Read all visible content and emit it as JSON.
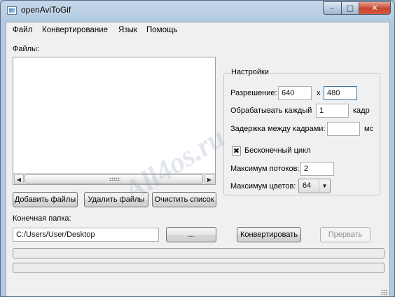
{
  "window": {
    "title": "openAviToGif",
    "minimize_glyph": "–",
    "maximize_glyph": "□",
    "close_glyph": "✕"
  },
  "menu": {
    "file": "Файл",
    "convert": "Конвертирование",
    "language": "Язык",
    "help": "Помощь"
  },
  "files": {
    "label": "Файлы:",
    "items": [],
    "scroll_left": "◀",
    "scroll_right": "▶"
  },
  "buttons": {
    "add_files": "Добавить файлы",
    "remove_files": "Удалить файлы",
    "clear_list": "Очистить список",
    "browse": "...",
    "convert": "Конвертировать",
    "abort": "Прервать"
  },
  "output": {
    "label": "Конечная папка:",
    "path": "C:/Users/User/Desktop"
  },
  "settings": {
    "title": "Настройки",
    "resolution_label": "Разрешение:",
    "width": "640",
    "times": "x",
    "height": "480",
    "process_every_label": "Обрабатывать каждый",
    "process_every": "1",
    "frame_unit": "кадр",
    "delay_label": "Задержка между кадрами:",
    "delay": "",
    "delay_unit": "мс",
    "loop_label": "Бесконечный цикл",
    "loop_checked": true,
    "loop_mark": "✖",
    "max_threads_label": "Максимум потоков:",
    "max_threads": "2",
    "max_colors_label": "Максимум цветов:",
    "max_colors": "64",
    "combo_arrow": "▼"
  },
  "progress": {
    "current": 0,
    "total": 0
  },
  "watermark": "All4os.ru",
  "colors": {
    "title_bar": "#b2c9df",
    "close_button": "#c5452f",
    "focus_border": "#3d7bad",
    "progress_fill": "#36b125"
  }
}
